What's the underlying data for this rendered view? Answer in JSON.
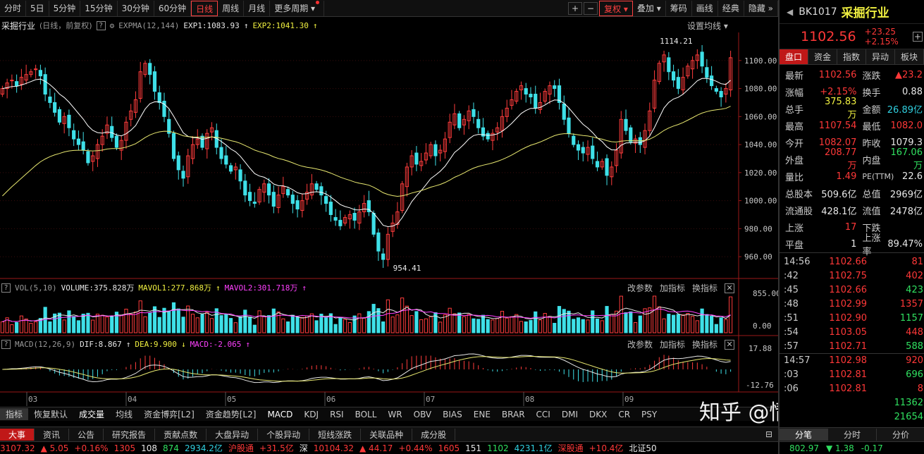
{
  "toolbar": {
    "periods": [
      "分时",
      "5日",
      "5分钟",
      "15分钟",
      "30分钟",
      "60分钟",
      "日线",
      "周线",
      "月线",
      "更多周期"
    ],
    "active_period": "日线",
    "right_buttons": [
      "复权",
      "叠加",
      "筹码",
      "画线",
      "经典",
      "隐藏"
    ],
    "plus": "+",
    "minus": "−"
  },
  "main_info": {
    "name": "采掘行业",
    "mode": "(日线，前复权)",
    "indicator": "EXPMA(12,144)",
    "exp1": "EXP1:1083.93",
    "exp2": "EXP2:1041.30",
    "settings": "设置均线"
  },
  "vol_info": {
    "name": "VOL(5,10)",
    "volume": "VOLUME:375.828万",
    "mavol1": "MAVOL1:277.868万",
    "mavol2": "MAVOL2:301.718万",
    "actions": [
      "改参数",
      "加指标",
      "换指标"
    ]
  },
  "macd_info": {
    "name": "MACD(12,26,9)",
    "dif": "DIF:8.867",
    "dea": "DEA:9.900",
    "macd": "MACD:-2.065",
    "actions": [
      "改参数",
      "加指标",
      "换指标"
    ]
  },
  "chart_data": {
    "type": "candlestick",
    "price_axis": [
      "1100.00",
      "1080.00",
      "1060.00",
      "1040.00",
      "1020.00",
      "1000.00",
      "980.00",
      "960.00"
    ],
    "price_range": [
      952,
      1114
    ],
    "annotations": {
      "high": "1114.21",
      "low": "954.41"
    },
    "vol_axis": [
      "855.00",
      "0.00"
    ],
    "macd_axis": [
      "17.88",
      "-12.76"
    ],
    "month_labels": [
      "03",
      "04",
      "05",
      "06",
      "07",
      "08",
      "09"
    ],
    "closes": [
      1080,
      1084,
      1086,
      1082,
      1088,
      1090,
      1092,
      1094,
      1089,
      1076,
      1070,
      1063,
      1056,
      1060,
      1052,
      1044,
      1040,
      1036,
      1027,
      1032,
      1040,
      1046,
      1054,
      1045,
      1038,
      1043,
      1056,
      1064,
      1072,
      1092,
      1098,
      1090,
      1078,
      1070,
      1060,
      1048,
      1030,
      1022,
      1016,
      1032,
      1040,
      1044,
      1038,
      1048,
      1052,
      1038,
      1030,
      1026,
      1021,
      1024,
      1014,
      1004,
      1000,
      998,
      1008,
      1012,
      1004,
      996,
      1004,
      1010,
      1004,
      998,
      994,
      1000,
      1006,
      1012,
      1008,
      1004,
      998,
      990,
      986,
      982,
      988,
      990,
      986,
      992,
      998,
      992,
      976,
      964,
      958,
      976,
      984,
      992,
      1012,
      1024,
      1032,
      1026,
      1028,
      1034,
      1040,
      1032,
      1036,
      1044,
      1056,
      1062,
      1052,
      1058,
      1064,
      1060,
      1052,
      1046,
      1044,
      1048,
      1052,
      1060,
      1066,
      1072,
      1078,
      1082,
      1076,
      1074,
      1066,
      1070,
      1078,
      1082,
      1080,
      1070,
      1058,
      1048,
      1040,
      1036,
      1034,
      1038,
      1030,
      1024,
      1028,
      1018,
      1024,
      1036,
      1058,
      1050,
      1042,
      1044,
      1040,
      1050,
      1064,
      1086,
      1098,
      1104,
      1092,
      1086,
      1080,
      1088,
      1096,
      1100,
      1104,
      1096,
      1088,
      1082,
      1078,
      1074,
      1080,
      1102
    ]
  },
  "right_panel": {
    "code": "BK1017",
    "name": "采掘行业",
    "price": "1102.56",
    "change": "+23.25",
    "change_pct": "+2.15%",
    "tabs": [
      "盘口",
      "资金",
      "指数",
      "异动",
      "板块"
    ],
    "quotes": [
      {
        "l1": "最新",
        "v1": "1102.56",
        "c1": "red",
        "l2": "涨跌",
        "v2": "▲23.2",
        "c2": "red"
      },
      {
        "l1": "涨幅",
        "v1": "+2.15%",
        "c1": "red",
        "l2": "换手",
        "v2": "0.88",
        "c2": "white"
      },
      {
        "l1": "总手",
        "v1": "375.83万",
        "c1": "yellow",
        "l2": "金额",
        "v2": "26.89亿",
        "c2": "cyan"
      },
      {
        "l1": "最高",
        "v1": "1107.54",
        "c1": "red",
        "l2": "最低",
        "v2": "1082.0",
        "c2": "red"
      },
      {
        "l1": "今开",
        "v1": "1082.07",
        "c1": "red",
        "l2": "昨收",
        "v2": "1079.3",
        "c2": "white"
      },
      {
        "l1": "外盘",
        "v1": "208.77万",
        "c1": "red",
        "l2": "内盘",
        "v2": "167.06万",
        "c2": "green"
      },
      {
        "l1": "量比",
        "v1": "1.49",
        "c1": "red",
        "l2": "PE(TTM)",
        "v2": "22.6",
        "c2": "white"
      },
      {
        "l1": "总股本",
        "v1": "509.6亿",
        "c1": "white",
        "l2": "总值",
        "v2": "2969亿",
        "c2": "white"
      },
      {
        "l1": "流通股",
        "v1": "428.1亿",
        "c1": "white",
        "l2": "流值",
        "v2": "2478亿",
        "c2": "white"
      },
      {
        "l1": "上涨",
        "v1": "17",
        "c1": "red",
        "l2": "下跌",
        "v2": "",
        "c2": "green"
      },
      {
        "l1": "平盘",
        "v1": "1",
        "c1": "white",
        "l2": "上涨率",
        "v2": "89.47%",
        "c2": "white"
      }
    ],
    "ticks": [
      {
        "t": "14:56",
        "p": "1102.66",
        "v": "81",
        "c": "red"
      },
      {
        "t": ":42",
        "p": "1102.75",
        "v": "402",
        "c": "red"
      },
      {
        "t": ":45",
        "p": "1102.66",
        "v": "423",
        "c": "green"
      },
      {
        "t": ":48",
        "p": "1102.99",
        "v": "1357",
        "c": "red"
      },
      {
        "t": ":51",
        "p": "1102.90",
        "v": "1157",
        "c": "green"
      },
      {
        "t": ":54",
        "p": "1103.05",
        "v": "448",
        "c": "red"
      },
      {
        "t": ":57",
        "p": "1102.71",
        "v": "588",
        "c": "green"
      },
      {
        "t": "14:57",
        "p": "1102.98",
        "v": "920",
        "c": "red"
      },
      {
        "t": ":03",
        "p": "1102.81",
        "v": "696",
        "c": "green"
      },
      {
        "t": ":06",
        "p": "1102.81",
        "v": "8",
        "c": "red"
      },
      {
        "t": "",
        "p": "",
        "v": "11362",
        "c": "green"
      },
      {
        "t": "",
        "p": "",
        "v": "21654",
        "c": "green"
      }
    ],
    "bottom_tabs": [
      "分笔",
      "分时",
      "分价"
    ]
  },
  "indicator_tabs": [
    "指标",
    "恢复默认",
    "成交量",
    "均线",
    "资金博弈[L2]",
    "资金趋势[L2]",
    "MACD",
    "KDJ",
    "RSI",
    "BOLL",
    "WR",
    "OBV",
    "BIAS",
    "ENE",
    "BRAR",
    "CCI",
    "DMI",
    "DKX",
    "CR",
    "PSY"
  ],
  "news_tabs": [
    "大事",
    "资讯",
    "公告",
    "研究报告",
    "贡献点数",
    "大盘异动",
    "个股异动",
    "短线涨跌",
    "关联品种",
    "成分股"
  ],
  "ticker": [
    {
      "text": "3107.32",
      "c": "red"
    },
    {
      "text": "▲ 5.05",
      "c": "red"
    },
    {
      "text": "+0.16%",
      "c": "red"
    },
    {
      "text": "1305",
      "c": "red"
    },
    {
      "text": "108",
      "c": "white"
    },
    {
      "text": "874",
      "c": "green"
    },
    {
      "text": "2934.2亿",
      "c": "cyan"
    },
    {
      "text": "沪股通",
      "c": "red"
    },
    {
      "text": "+31.5亿",
      "c": "red"
    },
    {
      "text": "深",
      "c": "white"
    },
    {
      "text": "10104.32",
      "c": "red"
    },
    {
      "text": "▲ 44.17",
      "c": "red"
    },
    {
      "text": "+0.44%",
      "c": "red"
    },
    {
      "text": "1605",
      "c": "red"
    },
    {
      "text": "151",
      "c": "white"
    },
    {
      "text": "1102",
      "c": "green"
    },
    {
      "text": "4231.1亿",
      "c": "cyan"
    },
    {
      "text": "深股通",
      "c": "red"
    },
    {
      "text": "+10.4亿",
      "c": "red"
    },
    {
      "text": "北证50",
      "c": "white"
    }
  ],
  "right_ticker": [
    {
      "text": "802.97",
      "c": "green"
    },
    {
      "text": "▼ 1.38",
      "c": "green"
    },
    {
      "text": "-0.17",
      "c": "green"
    }
  ],
  "watermark": "知乎 @情绪雷达"
}
